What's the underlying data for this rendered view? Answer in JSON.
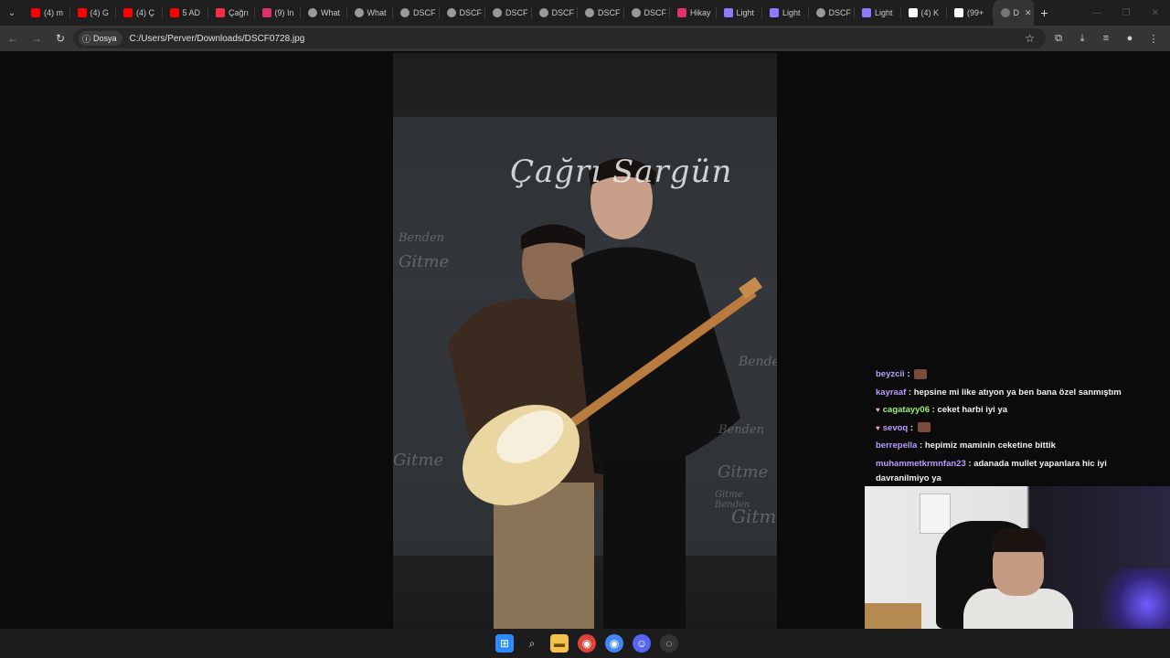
{
  "browser": {
    "tabs": [
      {
        "label": "(4) m",
        "icon": "youtube-icon",
        "color": "#ff0000"
      },
      {
        "label": "(4) G",
        "icon": "youtube-icon",
        "color": "#ff0000"
      },
      {
        "label": "(4) Ç",
        "icon": "youtube-icon",
        "color": "#ff0000"
      },
      {
        "label": "5 AD",
        "icon": "youtube-icon",
        "color": "#ff0000"
      },
      {
        "label": "Çağrı",
        "icon": "music-icon",
        "color": "#fa2d48"
      },
      {
        "label": "(9) In",
        "icon": "instagram-icon",
        "color": "#e1306c"
      },
      {
        "label": "What",
        "icon": "globe-icon",
        "color": "#9a9a9a"
      },
      {
        "label": "What",
        "icon": "globe-icon",
        "color": "#9a9a9a"
      },
      {
        "label": "DSCF",
        "icon": "globe-icon",
        "color": "#9a9a9a"
      },
      {
        "label": "DSCF",
        "icon": "globe-icon",
        "color": "#9a9a9a"
      },
      {
        "label": "DSCF",
        "icon": "globe-icon",
        "color": "#9a9a9a"
      },
      {
        "label": "DSCF",
        "icon": "globe-icon",
        "color": "#9a9a9a"
      },
      {
        "label": "DSCF",
        "icon": "globe-icon",
        "color": "#9a9a9a"
      },
      {
        "label": "DSCF",
        "icon": "globe-icon",
        "color": "#9a9a9a"
      },
      {
        "label": "Hikay",
        "icon": "instagram-icon",
        "color": "#e1306c"
      },
      {
        "label": "Light",
        "icon": "feather-icon",
        "color": "#8c7bff"
      },
      {
        "label": "Light",
        "icon": "feather-icon",
        "color": "#8c7bff"
      },
      {
        "label": "DSCF",
        "icon": "globe-icon",
        "color": "#9a9a9a"
      },
      {
        "label": "Light",
        "icon": "feather-icon",
        "color": "#8c7bff"
      },
      {
        "label": "(4) K",
        "icon": "x-icon",
        "color": "#ffffff"
      },
      {
        "label": "(99+",
        "icon": "tiktok-icon",
        "color": "#ffffff"
      }
    ],
    "active_tab": {
      "label": "D",
      "icon": "globe-icon"
    },
    "address_chip": "Dosya",
    "url": "C:/Users/Perver/Downloads/DSCF0728.jpg"
  },
  "photo": {
    "headline": "Çağrı Sargün",
    "backdrop_words": [
      "Benden",
      "Gitme",
      "Benden",
      "Gitme",
      "Benden",
      "Gitme",
      "Gitme Benden",
      "Gitme"
    ]
  },
  "chat": [
    {
      "user": "beyzcii",
      "color": "#b99cff",
      "message": "",
      "badge": "",
      "emote": true
    },
    {
      "user": "kayraaf",
      "color": "#b99cff",
      "message": "hepsine mi like atıyon ya ben bana özel sanmıştım",
      "badge": "",
      "emote": false
    },
    {
      "user": "cagatayy06",
      "color": "#9ef07a",
      "message": "ceket harbi iyi ya",
      "badge": "♥",
      "emote": false
    },
    {
      "user": "sevoq",
      "color": "#b99cff",
      "message": "",
      "badge": "♥",
      "emote": true
    },
    {
      "user": "berrepella",
      "color": "#b99cff",
      "message": "hepimiz maminin ceketine bittik",
      "badge": "",
      "emote": false
    },
    {
      "user": "muhammetkrmnfan23",
      "color": "#b99cff",
      "message": "adanada mullet yapanlara hic iyi davranilmiyo ya",
      "badge": "",
      "emote": false
    }
  ]
}
